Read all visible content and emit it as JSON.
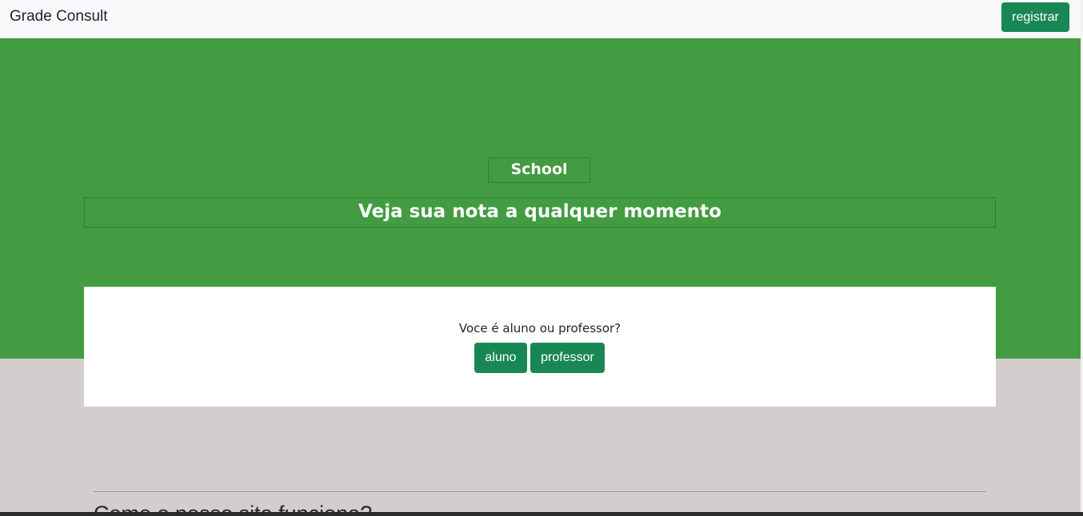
{
  "navbar": {
    "brand": "Grade Consult",
    "register_label": "registrar"
  },
  "hero": {
    "title": "School",
    "subtitle": "Veja sua nota a qualquer momento"
  },
  "card": {
    "question": "Voce é aluno ou professor?",
    "aluno_label": "aluno",
    "professor_label": "professor"
  },
  "section": {
    "heading": "Como o nosso site funciona?"
  },
  "colors": {
    "hero_background": "#439b42",
    "button_green": "#198754",
    "page_background": "#d3cdcd",
    "navbar_background": "#f8f9fa"
  }
}
